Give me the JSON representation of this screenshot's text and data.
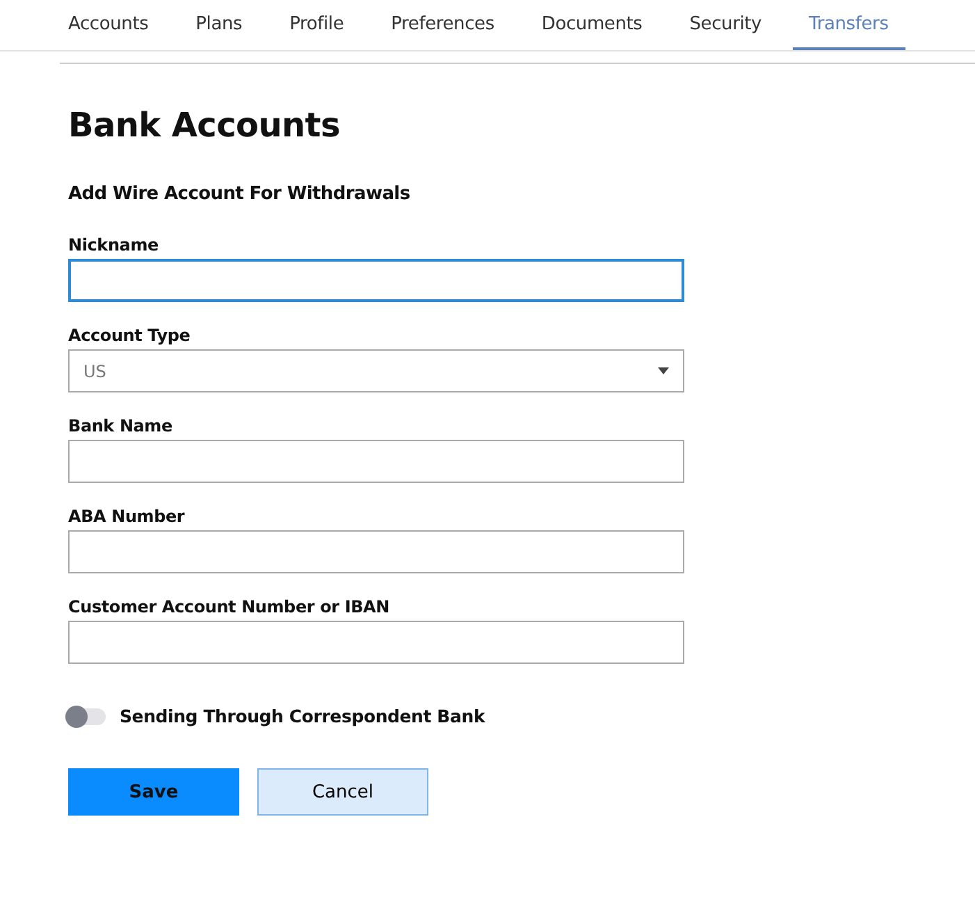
{
  "tabs": [
    {
      "label": "Accounts",
      "selected": false
    },
    {
      "label": "Plans",
      "selected": false
    },
    {
      "label": "Profile",
      "selected": false
    },
    {
      "label": "Preferences",
      "selected": false
    },
    {
      "label": "Documents",
      "selected": false
    },
    {
      "label": "Security",
      "selected": false
    },
    {
      "label": "Transfers",
      "selected": true
    }
  ],
  "title": "Bank Accounts",
  "subtitle": "Add Wire Account For Withdrawals",
  "fields": [
    {
      "kind": "text",
      "label": "Nickname",
      "focused": true
    },
    {
      "kind": "select",
      "label": "Account Type",
      "value": "US",
      "focused": false
    },
    {
      "kind": "text",
      "label": "Bank Name",
      "focused": false
    },
    {
      "kind": "text",
      "label": "ABA Number",
      "focused": false
    },
    {
      "kind": "text",
      "label": "Customer Account Number or IBAN",
      "focused": false
    }
  ],
  "toggle": {
    "label": "Sending Through Correspondent Bank",
    "on": false
  },
  "buttons": [
    {
      "kind": "primary",
      "label": "Save"
    },
    {
      "kind": "secondary",
      "label": "Cancel"
    }
  ]
}
